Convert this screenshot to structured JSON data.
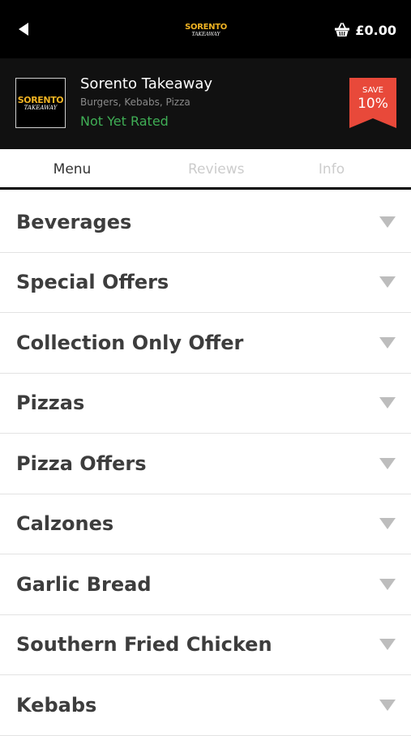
{
  "topbar": {
    "back_icon": "back-arrow-icon",
    "logo_line1": "SORENTO",
    "logo_line2": "TAKEAWAY",
    "basket_icon": "basket-icon",
    "basket_total": "£0.00"
  },
  "restaurant": {
    "logo_line1": "SORENTO",
    "logo_line2": "TAKEAWAY",
    "name": "Sorento Takeaway",
    "cuisines": "Burgers, Kebabs, Pizza",
    "rating": "Not Yet Rated",
    "save_label": "SAVE",
    "save_percent": "10%"
  },
  "tabs": [
    {
      "label": "Menu",
      "active": true
    },
    {
      "label": "Reviews",
      "active": false
    },
    {
      "label": "Info",
      "active": false
    }
  ],
  "categories": [
    {
      "label": "Beverages"
    },
    {
      "label": "Special Offers"
    },
    {
      "label": "Collection Only Offer"
    },
    {
      "label": "Pizzas"
    },
    {
      "label": "Pizza Offers"
    },
    {
      "label": "Calzones"
    },
    {
      "label": "Garlic Bread"
    },
    {
      "label": "Southern Fried Chicken"
    },
    {
      "label": "Kebabs"
    }
  ],
  "colors": {
    "accent_green": "#3fae55",
    "badge_red": "#e8493a",
    "logo_gold": "#f0b323",
    "chevron_gray": "#bdbdbd"
  }
}
